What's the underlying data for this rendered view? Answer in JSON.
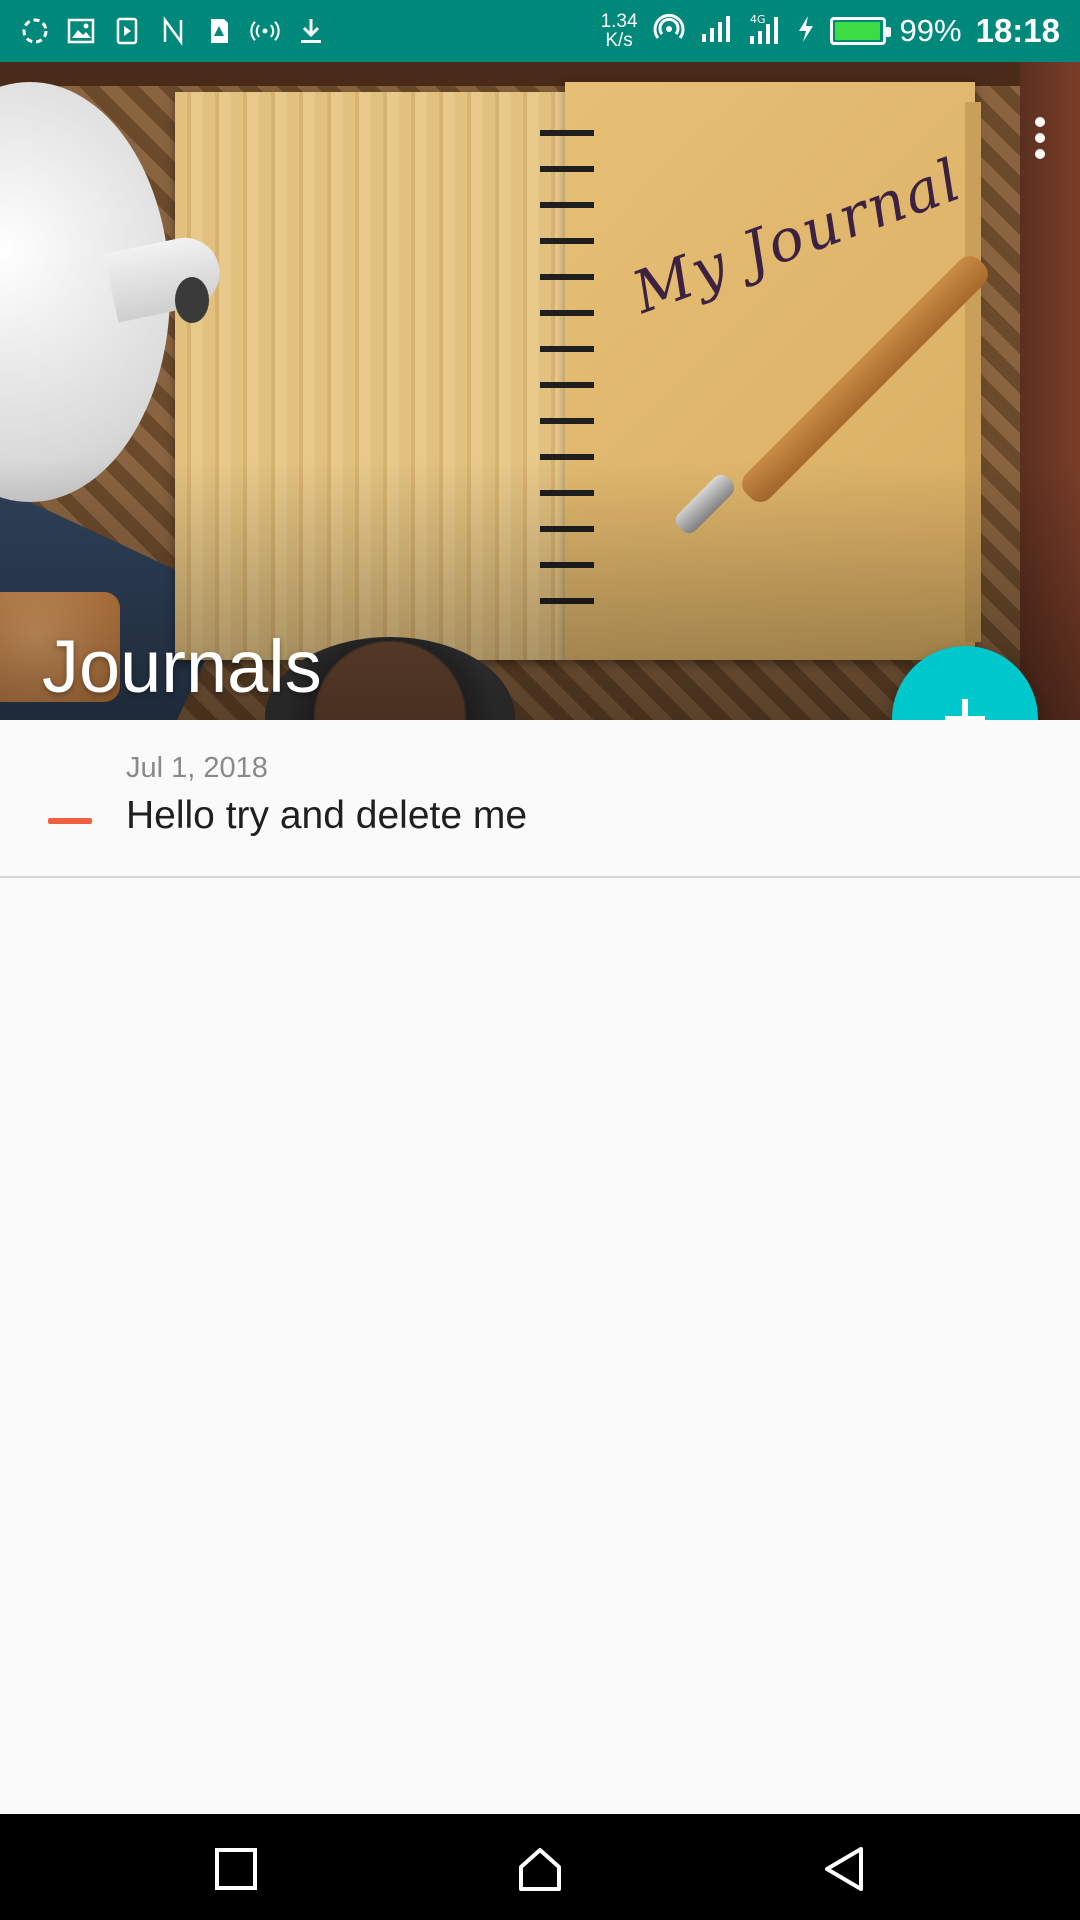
{
  "status_bar": {
    "net_speed_value": "1.34",
    "net_speed_unit": "K/s",
    "battery_percent": "99%",
    "battery_level": 0.99,
    "time": "18:18",
    "left_icons": [
      "sync-icon",
      "image-icon",
      "media-icon",
      "nfc-icon",
      "sim-alert-icon",
      "hotspot-icon",
      "download-icon"
    ],
    "right_icons": [
      "wifi-icon",
      "signal-icon",
      "signal-4g-icon",
      "charging-icon",
      "battery-icon"
    ]
  },
  "header": {
    "title": "Journals",
    "background_image": "notebook-my-journal-photo",
    "image_script_text": "My Journal",
    "overflow_menu_icon": "more-vert-icon"
  },
  "fab": {
    "icon": "plus-icon",
    "color": "#00c8cc"
  },
  "journal_list": {
    "items": [
      {
        "date": "Jul 1, 2018",
        "title": "Hello try and delete me",
        "delete_icon": "minus-icon"
      }
    ]
  },
  "nav_bar": {
    "buttons": [
      "recents-square-icon",
      "home-icon",
      "back-triangle-icon"
    ]
  },
  "colors": {
    "status_bar": "#00897b",
    "accent": "#00c8cc",
    "delete": "#f06040",
    "background": "#fafafa"
  }
}
